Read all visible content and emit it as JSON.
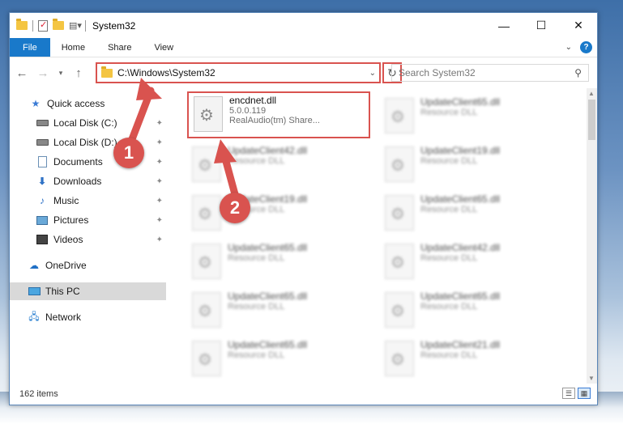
{
  "window": {
    "title": "System32"
  },
  "ribbon": {
    "tabs": [
      "File",
      "Home",
      "Share",
      "View"
    ],
    "help_label": "?"
  },
  "nav": {
    "back_icon": "left-arrow-icon",
    "address": "C:\\Windows\\System32",
    "search_placeholder": "Search System32"
  },
  "sidebar": {
    "items": [
      {
        "label": "Quick access",
        "icon": "star-icon"
      },
      {
        "label": "Local Disk (C:)",
        "icon": "disk-icon",
        "pinned": true
      },
      {
        "label": "Local Disk (D:)",
        "icon": "disk-icon",
        "pinned": true
      },
      {
        "label": "Documents",
        "icon": "documents-icon",
        "pinned": true
      },
      {
        "label": "Downloads",
        "icon": "download-icon",
        "pinned": true
      },
      {
        "label": "Music",
        "icon": "music-icon",
        "pinned": true
      },
      {
        "label": "Pictures",
        "icon": "pictures-icon",
        "pinned": true
      },
      {
        "label": "Videos",
        "icon": "videos-icon",
        "pinned": true
      },
      {
        "label": "OneDrive",
        "icon": "cloud-icon"
      },
      {
        "label": "This PC",
        "icon": "pc-icon",
        "selected": true
      },
      {
        "label": "Network",
        "icon": "network-icon"
      }
    ]
  },
  "files": {
    "selected": {
      "name": "encdnet.dll",
      "version": "5.0.0.119",
      "description": "RealAudio(tm) Share..."
    },
    "left": [
      {
        "name": "UpdateClient42.dll",
        "type": "Resource DLL"
      },
      {
        "name": "UpdateClient19.dll",
        "type": "Resource DLL"
      },
      {
        "name": "UpdateClient65.dll",
        "type": "Resource DLL"
      },
      {
        "name": "UpdateClient65.dll",
        "type": "Resource DLL"
      },
      {
        "name": "UpdateClient65.dll",
        "type": "Resource DLL"
      }
    ],
    "right": [
      {
        "name": "UpdateClient65.dll",
        "type": "Resource DLL"
      },
      {
        "name": "UpdateClient19.dll",
        "type": "Resource DLL"
      },
      {
        "name": "UpdateClient65.dll",
        "type": "Resource DLL"
      },
      {
        "name": "UpdateClient42.dll",
        "type": "Resource DLL"
      },
      {
        "name": "UpdateClient65.dll",
        "type": "Resource DLL"
      },
      {
        "name": "UpdateClient21.dll",
        "type": "Resource DLL"
      }
    ]
  },
  "status": {
    "item_count": "162 items"
  },
  "annotations": {
    "step1": "1",
    "step2": "2",
    "color": "#d9534f"
  }
}
